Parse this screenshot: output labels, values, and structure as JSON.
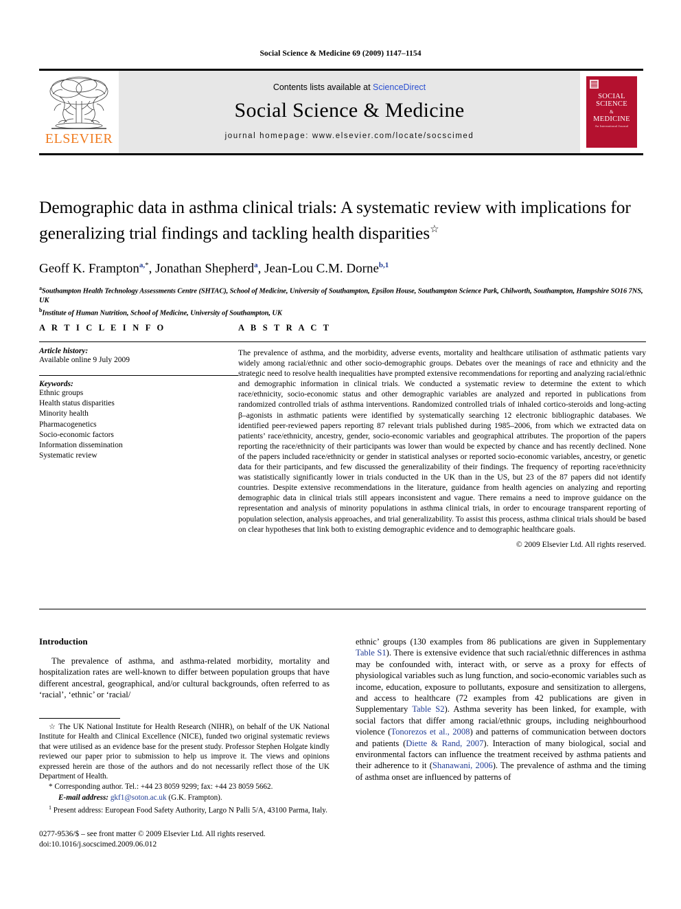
{
  "running_head": "Social Science & Medicine 69 (2009) 1147–1154",
  "masthead": {
    "contents_prefix": "Contents lists available at",
    "contents_link": "ScienceDirect",
    "journal_title": "Social Science & Medicine",
    "homepage_line": "journal homepage: www.elsevier.com/locate/socscimed",
    "publisher_name": "ELSEVIER",
    "publisher_color": "#F07C20",
    "cover_line1": "SOCIAL",
    "cover_line2": "SCIENCE",
    "cover_amp": "&",
    "cover_line3": "MEDICINE",
    "cover_sub": "An International Journal",
    "cover_color": "#b4112f"
  },
  "article": {
    "title_line1": "Demographic data in asthma clinical trials: A systematic review with implications",
    "title_line2": "for generalizing trial findings and tackling health disparities",
    "title_star": "☆",
    "authors": [
      {
        "name": "Geoff K. Frampton",
        "marks": "a,",
        "star": "*"
      },
      {
        "name": "Jonathan Shepherd",
        "marks": "a",
        "star": ""
      },
      {
        "name": "Jean-Lou C.M. Dorne",
        "marks": "b,1",
        "star": ""
      }
    ],
    "affiliation_a_mark": "a",
    "affiliation_a": "Southampton Health Technology Assessments Centre (SHTAC), School of Medicine, University of Southampton, Epsilon House, Southampton Science Park, Chilworth, Southampton, Hampshire SO16 7NS, UK",
    "affiliation_b_mark": "b",
    "affiliation_b": "Institute of Human Nutrition, School of Medicine, University of Southampton, UK"
  },
  "article_info": {
    "heading": "A R T I C L E  I N F O",
    "history_label": "Article history:",
    "history_value": "Available online 9 July 2009",
    "keywords_label": "Keywords:",
    "keywords": [
      "Ethnic groups",
      "Health status disparities",
      "Minority health",
      "Pharmacogenetics",
      "Socio-economic factors",
      "Information dissemination",
      "Systematic review"
    ]
  },
  "abstract": {
    "heading": "A B S T R A C T",
    "text": "The prevalence of asthma, and the morbidity, adverse events, mortality and healthcare utilisation of asthmatic patients vary widely among racial/ethnic and other socio-demographic groups. Debates over the meanings of race and ethnicity and the strategic need to resolve health inequalities have prompted extensive recommendations for reporting and analyzing racial/ethnic and demographic information in clinical trials. We conducted a systematic review to determine the extent to which race/ethnicity, socio-economic status and other demographic variables are analyzed and reported in publications from randomized controlled trials of asthma interventions. Randomized controlled trials of inhaled cortico-steroids and long-acting β–agonists in asthmatic patients were identified by systematically searching 12 electronic bibliographic databases. We identified peer-reviewed papers reporting 87 relevant trials published during 1985–2006, from which we extracted data on patients’ race/ethnicity, ancestry, gender, socio-economic variables and geographical attributes. The proportion of the papers reporting the race/ethnicity of their participants was lower than would be expected by chance and has recently declined. None of the papers included race/ethnicity or gender in statistical analyses or reported socio-economic variables, ancestry, or genetic data for their participants, and few discussed the generalizability of their findings. The frequency of reporting race/ethnicity was statistically significantly lower in trials conducted in the UK than in the US, but 23 of the 87 papers did not identify countries. Despite extensive recommendations in the literature, guidance from health agencies on analyzing and reporting demographic data in clinical trials still appears inconsistent and vague. There remains a need to improve guidance on the representation and analysis of minority populations in asthma clinical trials, in order to encourage transparent reporting of population selection, analysis approaches, and trial generalizability. To assist this process, asthma clinical trials should be based on clear hypotheses that link both to existing demographic evidence and to demographic healthcare goals.",
    "copyright": "© 2009 Elsevier Ltd. All rights reserved."
  },
  "introduction": {
    "heading": "Introduction",
    "left_paragraph": "The prevalence of asthma, and asthma-related morbidity, mortality and hospitalization rates are well-known to differ between population groups that have different ancestral, geographical, and/or cultural backgrounds, often referred to as ‘racial’, ‘ethnic’ or ‘racial/",
    "right_paragraph_part1": "ethnic’ groups (130 examples from 86 publications are given in Supplementary ",
    "right_link1": "Table S1",
    "right_paragraph_part2": "). There is extensive evidence that such racial/ethnic differences in asthma may be confounded with, interact with, or serve as a proxy for effects of physiological variables such as lung function, and socio-economic variables such as income, education, exposure to pollutants, exposure and sensitization to allergens, and access to healthcare (72 examples from 42 publications are given in Supplementary ",
    "right_link2": "Table S2",
    "right_paragraph_part3": "). Asthma severity has been linked, for example, with social factors that differ among racial/ethnic groups, including neighbourhood violence (",
    "right_link3": "Tonorezos et al., 2008",
    "right_paragraph_part4": ") and patterns of communication between doctors and patients (",
    "right_link4": "Diette & Rand, 2007",
    "right_paragraph_part5": "). Interaction of many biological, social and environmental factors can influence the treatment received by asthma patients and their adherence to it (",
    "right_link5": "Shanawani, 2006",
    "right_paragraph_part6": "). The prevalence of asthma and the timing of asthma onset are influenced by patterns of"
  },
  "footnotes": {
    "star_mark": "☆",
    "star_text": "The UK National Institute for Health Research (NIHR), on behalf of the UK National Institute for Health and Clinical Excellence (NICE), funded two original systematic reviews that were utilised as an evidence base for the present study. Professor Stephen Holgate kindly reviewed our paper prior to submission to help us improve it. The views and opinions expressed herein are those of the authors and do not necessarily reflect those of the UK Department of Health.",
    "corresponding_mark": "*",
    "corresponding_text": "Corresponding author. Tel.: +44 23 8059 9299; fax: +44 23 8059 5662.",
    "email_label": "E-mail address:",
    "email_value": "gkf1@soton.ac.uk",
    "email_owner": "(G.K. Frampton).",
    "present_mark": "1",
    "present_text": "Present address: European Food Safety Authority, Largo N Palli 5/A, 43100 Parma, Italy."
  },
  "imprint": {
    "line1": "0277-9536/$ – see front matter © 2009 Elsevier Ltd. All rights reserved.",
    "line2": "doi:10.1016/j.socscimed.2009.06.012"
  }
}
